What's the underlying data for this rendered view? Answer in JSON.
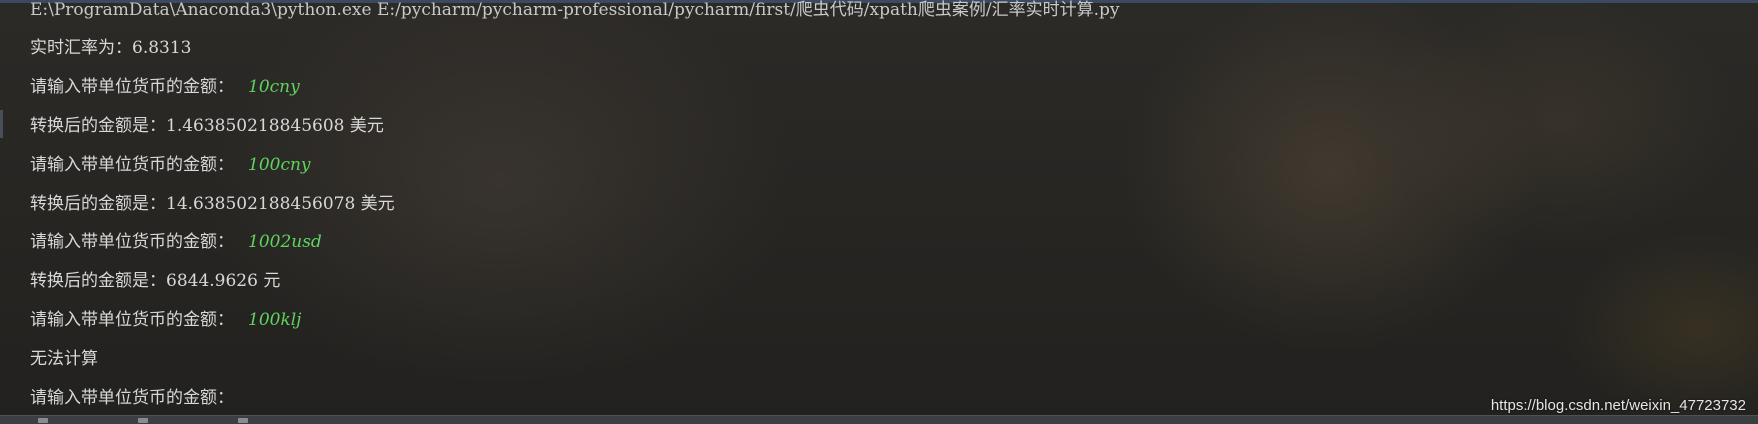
{
  "console": {
    "command": "E:\\ProgramData\\Anaconda3\\python.exe E:/pycharm/pycharm-professional/pycharm/first/爬虫代码/xpath爬虫案例/汇率实时计算.py",
    "rate_line": "实时汇率为：6.8313",
    "lines": [
      {
        "prompt": "请输入带单位货币的金额：",
        "input": "10cny"
      },
      {
        "output": "转换后的金额是：1.463850218845608 美元"
      },
      {
        "prompt": "请输入带单位货币的金额：",
        "input": "100cny"
      },
      {
        "output": "转换后的金额是：14.638502188456078 美元"
      },
      {
        "prompt": "请输入带单位货币的金额：",
        "input": "1002usd"
      },
      {
        "output": "转换后的金额是：6844.9626 元"
      },
      {
        "prompt": "请输入带单位货币的金额：",
        "input": "100klj"
      },
      {
        "output": "无法计算"
      },
      {
        "prompt": "请输入带单位货币的金额：",
        "input": ""
      }
    ]
  },
  "watermark": "https://blog.csdn.net/weixin_47723732",
  "colors": {
    "input_text": "#5fd35f",
    "output_text": "#d8d8d8"
  }
}
